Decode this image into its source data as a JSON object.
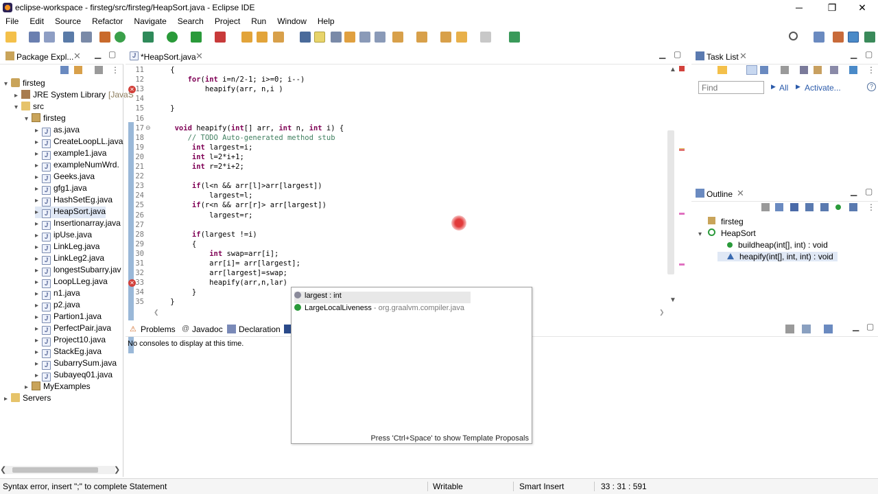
{
  "window": {
    "title": "eclipse-workspace - firsteg/src/firsteg/HeapSort.java - Eclipse IDE",
    "minimize": "─",
    "restore": "❐",
    "close": "✕"
  },
  "menu": [
    "File",
    "Edit",
    "Source",
    "Refactor",
    "Navigate",
    "Search",
    "Project",
    "Run",
    "Window",
    "Help"
  ],
  "package_explorer": {
    "tab_label": "Package Expl...",
    "tree": [
      {
        "label": "firsteg",
        "indent": 0,
        "icon": "project-icon",
        "arrow": "▾"
      },
      {
        "label": "JRE System Library",
        "suffix": "[JavaS",
        "indent": 1,
        "icon": "library-icon",
        "arrow": "▸"
      },
      {
        "label": "src",
        "indent": 1,
        "icon": "folder-icon",
        "arrow": "▾"
      },
      {
        "label": "firsteg",
        "indent": 2,
        "icon": "package-icon",
        "arrow": "▾"
      },
      {
        "label": "as.java",
        "indent": 3,
        "icon": "java-file-icon",
        "arrow": "▸"
      },
      {
        "label": "CreateLoopLL.java",
        "indent": 3,
        "icon": "java-file-icon",
        "arrow": "▸"
      },
      {
        "label": "example1.java",
        "indent": 3,
        "icon": "java-file-icon",
        "arrow": "▸"
      },
      {
        "label": "exampleNumWrd.",
        "indent": 3,
        "icon": "java-file-icon",
        "arrow": "▸"
      },
      {
        "label": "Geeks.java",
        "indent": 3,
        "icon": "java-file-icon",
        "arrow": "▸"
      },
      {
        "label": "gfg1.java",
        "indent": 3,
        "icon": "java-file-icon",
        "arrow": "▸"
      },
      {
        "label": "HashSetEg.java",
        "indent": 3,
        "icon": "java-file-icon",
        "arrow": "▸"
      },
      {
        "label": "HeapSort.java",
        "indent": 3,
        "icon": "java-file-icon",
        "arrow": "▸",
        "selected": true
      },
      {
        "label": "Insertionarray.java",
        "indent": 3,
        "icon": "java-file-icon",
        "arrow": "▸"
      },
      {
        "label": "ipUse.java",
        "indent": 3,
        "icon": "java-file-icon",
        "arrow": "▸"
      },
      {
        "label": "LinkLeg.java",
        "indent": 3,
        "icon": "java-file-icon",
        "arrow": "▸"
      },
      {
        "label": "LinkLeg2.java",
        "indent": 3,
        "icon": "java-file-icon",
        "arrow": "▸"
      },
      {
        "label": "longestSubarry.jav",
        "indent": 3,
        "icon": "java-file-icon",
        "arrow": "▸"
      },
      {
        "label": "LoopLLeg.java",
        "indent": 3,
        "icon": "java-file-icon",
        "arrow": "▸"
      },
      {
        "label": "n1.java",
        "indent": 3,
        "icon": "java-file-icon",
        "arrow": "▸"
      },
      {
        "label": "p2.java",
        "indent": 3,
        "icon": "java-file-icon",
        "arrow": "▸"
      },
      {
        "label": "Partion1.java",
        "indent": 3,
        "icon": "java-file-icon",
        "arrow": "▸"
      },
      {
        "label": "PerfectPair.java",
        "indent": 3,
        "icon": "java-file-icon",
        "arrow": "▸"
      },
      {
        "label": "Project10.java",
        "indent": 3,
        "icon": "java-file-icon",
        "arrow": "▸"
      },
      {
        "label": "StackEg.java",
        "indent": 3,
        "icon": "java-file-icon",
        "arrow": "▸"
      },
      {
        "label": "SubarrySum.java",
        "indent": 3,
        "icon": "java-file-icon",
        "arrow": "▸"
      },
      {
        "label": "Subayeq01.java",
        "indent": 3,
        "icon": "java-file-icon",
        "arrow": "▸"
      },
      {
        "label": "MyExamples",
        "indent": 2,
        "icon": "package-icon",
        "arrow": "▸"
      },
      {
        "label": "Servers",
        "indent": 0,
        "icon": "folder-icon",
        "arrow": "▸"
      }
    ]
  },
  "editor": {
    "tab_label": "*HeapSort.java",
    "lines": [
      {
        "n": "11",
        "code": [
          [
            "tx",
            "    {"
          ]
        ]
      },
      {
        "n": "12",
        "code": [
          [
            "tx",
            "        "
          ],
          [
            "kw",
            "for"
          ],
          [
            "tx",
            "("
          ],
          [
            "kw",
            "int"
          ],
          [
            "tx",
            " i=n/2-1; i>=0; i--)"
          ]
        ]
      },
      {
        "n": "13",
        "code": [
          [
            "tx",
            "            heapify(arr, n,i )"
          ]
        ],
        "error": true
      },
      {
        "n": "14",
        "code": []
      },
      {
        "n": "15",
        "code": [
          [
            "tx",
            "    }"
          ]
        ]
      },
      {
        "n": "16",
        "code": []
      },
      {
        "n": "17",
        "code": [
          [
            "tx",
            "     "
          ],
          [
            "kw",
            "void"
          ],
          [
            "tx",
            " heapify("
          ],
          [
            "kw",
            "int"
          ],
          [
            "tx",
            "[] arr, "
          ],
          [
            "kw",
            "int"
          ],
          [
            "tx",
            " n, "
          ],
          [
            "kw",
            "int"
          ],
          [
            "tx",
            " i) {"
          ]
        ],
        "fold": true
      },
      {
        "n": "18",
        "code": [
          [
            "tx",
            "        "
          ],
          [
            "cm",
            "// TODO Auto-generated method stub"
          ]
        ]
      },
      {
        "n": "19",
        "code": [
          [
            "tx",
            "         "
          ],
          [
            "kw",
            "int"
          ],
          [
            "tx",
            " largest=i;"
          ]
        ]
      },
      {
        "n": "20",
        "code": [
          [
            "tx",
            "         "
          ],
          [
            "kw",
            "int"
          ],
          [
            "tx",
            " l=2*i+1;"
          ]
        ]
      },
      {
        "n": "21",
        "code": [
          [
            "tx",
            "         "
          ],
          [
            "kw",
            "int"
          ],
          [
            "tx",
            " r=2*i+2;"
          ]
        ]
      },
      {
        "n": "22",
        "code": []
      },
      {
        "n": "23",
        "code": [
          [
            "tx",
            "         "
          ],
          [
            "kw",
            "if"
          ],
          [
            "tx",
            "(l<n && arr[l]>arr[largest])"
          ]
        ]
      },
      {
        "n": "24",
        "code": [
          [
            "tx",
            "             largest=l;"
          ]
        ]
      },
      {
        "n": "25",
        "code": [
          [
            "tx",
            "         "
          ],
          [
            "kw",
            "if"
          ],
          [
            "tx",
            "(r<n && arr[r]> arr[largest])"
          ]
        ]
      },
      {
        "n": "26",
        "code": [
          [
            "tx",
            "             largest=r;"
          ]
        ]
      },
      {
        "n": "27",
        "code": []
      },
      {
        "n": "28",
        "code": [
          [
            "tx",
            "         "
          ],
          [
            "kw",
            "if"
          ],
          [
            "tx",
            "(largest !=i)"
          ]
        ]
      },
      {
        "n": "29",
        "code": [
          [
            "tx",
            "         {"
          ]
        ]
      },
      {
        "n": "30",
        "code": [
          [
            "tx",
            "             "
          ],
          [
            "kw",
            "int"
          ],
          [
            "tx",
            " swap=arr[i];"
          ]
        ]
      },
      {
        "n": "31",
        "code": [
          [
            "tx",
            "             arr[i]= arr[largest];"
          ]
        ]
      },
      {
        "n": "32",
        "code": [
          [
            "tx",
            "             arr[largest]=swap;"
          ]
        ]
      },
      {
        "n": "33",
        "code": [
          [
            "tx",
            "             heapify(arr,n,lar)"
          ]
        ],
        "error": true
      },
      {
        "n": "34",
        "code": [
          [
            "tx",
            "         }"
          ]
        ]
      },
      {
        "n": "35",
        "code": [
          [
            "tx",
            "    }"
          ]
        ]
      }
    ]
  },
  "autocomplete": {
    "proposals": [
      {
        "name": "largest : int",
        "detail": "",
        "icon": "local-variable-icon"
      },
      {
        "name": "LargeLocalLiveness",
        "detail": " - org.graalvm.compiler.java",
        "icon": "class-icon"
      }
    ],
    "footer": "Press 'Ctrl+Space' to show Template Proposals"
  },
  "bottom_panel": {
    "tabs": [
      "Problems",
      "Javadoc",
      "Declaration"
    ],
    "message": "No consoles to display at this time."
  },
  "task_list": {
    "tab_label": "Task List",
    "find_placeholder": "Find",
    "all_label": "All",
    "activate_label": "Activate..."
  },
  "outline": {
    "tab_label": "Outline",
    "items": [
      {
        "label": "firsteg",
        "indent": 0,
        "icon": "package-icon",
        "arrow": ""
      },
      {
        "label": "HeapSort",
        "indent": 0,
        "icon": "class-icon",
        "arrow": "▾"
      },
      {
        "label": "buildheap(int[], int) : void",
        "indent": 1,
        "icon": "method-public-icon",
        "arrow": ""
      },
      {
        "label": "heapify(int[], int, int) : void",
        "indent": 1,
        "icon": "method-default-icon",
        "arrow": "",
        "selected": true
      }
    ]
  },
  "status": {
    "message": "Syntax error, insert \";\" to complete Statement",
    "writable": "Writable",
    "insert_mode": "Smart Insert",
    "position": "33 : 31 : 591"
  },
  "colors": {
    "keyword": "#7f0055",
    "comment": "#3f7f5f",
    "error": "#d2413b",
    "selection": "#e0e8f5"
  }
}
